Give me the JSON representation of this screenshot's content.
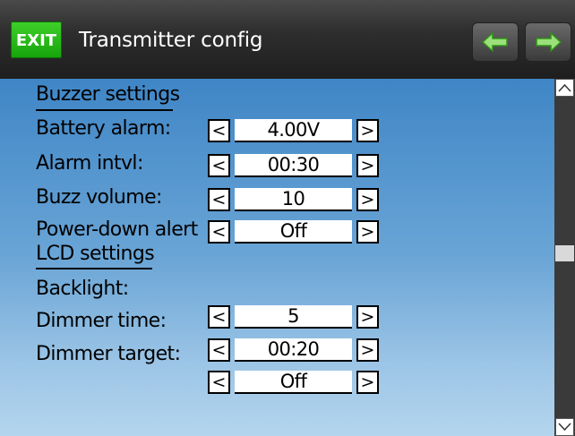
{
  "header": {
    "exit_label": "EXIT",
    "title": "Transmitter config",
    "back_icon": "arrow-left-icon",
    "forward_icon": "arrow-right-icon"
  },
  "sections": [
    {
      "title": "Buzzer settings",
      "rows": [
        {
          "label": "Battery alarm:",
          "value": "4.00V"
        },
        {
          "label": "Alarm intvl:",
          "value": "00:30"
        },
        {
          "label": "Buzz volume:",
          "value": "10"
        },
        {
          "label": "Power-down alert",
          "value": "Off"
        }
      ]
    },
    {
      "title": "LCD settings",
      "rows": [
        {
          "label": "Backlight:",
          "value": "5"
        },
        {
          "label": "Dimmer time:",
          "value": "00:20"
        },
        {
          "label": "Dimmer target:",
          "value": "Off"
        }
      ]
    }
  ],
  "controls": {
    "decrement": "<",
    "increment": ">"
  },
  "colors": {
    "exit_green": "#16a40a",
    "nav_arrow_green": "#4ed62a",
    "background_top": "#3f86c6",
    "background_bottom": "#b4d5ee"
  }
}
